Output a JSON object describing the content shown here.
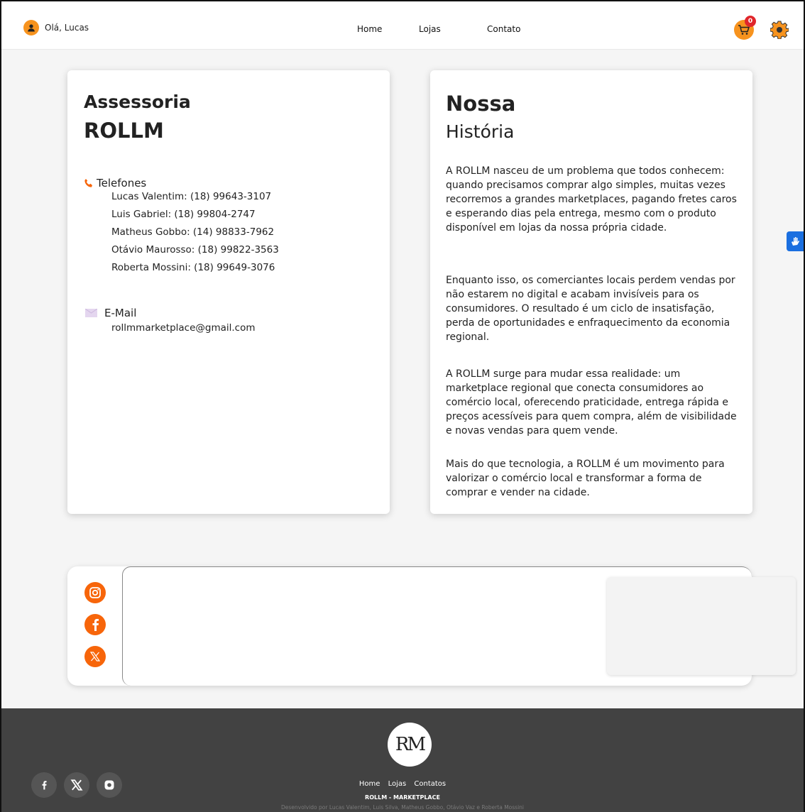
{
  "header": {
    "greeting": "Olá, Lucas",
    "nav": [
      "Home",
      "Lojas",
      "Contato"
    ],
    "cart_count": "0"
  },
  "assessoria": {
    "title_line1": "Assessoria",
    "title_line2": "ROLLM",
    "phones_label": "Telefones",
    "phones": [
      "Lucas Valentim: (18) 99643-3107",
      "Luis Gabriel: (18) 99804-2747",
      "Matheus Gobbo: (14) 98833-7962",
      "Otávio Maurosso: (18) 99822-3563",
      "Roberta Mossini: (18) 99649-3076"
    ],
    "email_label": "E-Mail",
    "email": "rollmmarketplace@gmail.com"
  },
  "historia": {
    "title_line1": "Nossa",
    "title_line2": "História",
    "paragraphs": [
      "A ROLLM nasceu de um problema que todos conhecem: quando precisamos comprar algo simples, muitas vezes recorremos a grandes marketplaces, pagando fretes caros e esperando dias pela entrega, mesmo com o produto disponível em lojas da nossa própria cidade.",
      "Enquanto isso, os comerciantes locais perdem vendas por não estarem no digital e acabam invisíveis para os consumidores. O resultado é um ciclo de insatisfação, perda de oportunidades e enfraquecimento da economia regional.",
      "A ROLLM surge para mudar essa realidade: um marketplace regional que conecta consumidores ao comércio local, oferecendo praticidade, entrega rápida e preços acessíveis para quem compra, além de visibilidade e novas vendas para quem vende.",
      "Mais do que tecnologia, a ROLLM é um movimento para valorizar o comércio local e transformar a forma de comprar e vender na cidade."
    ]
  },
  "social": {
    "icons": [
      "instagram-icon",
      "facebook-icon",
      "x-icon"
    ]
  },
  "footer": {
    "logo_text": "RM",
    "nav": [
      "Home",
      "Lojas",
      "Contatos"
    ],
    "title": "ROLLM - MARKETPLACE",
    "credit": "Desenvolvido por Lucas Valentim, Luis Silva, Matheus Gobbo, Otávio Vaz e Roberta Mossini"
  },
  "colors": {
    "accent": "#f7931e",
    "social_orange": "#f7650a",
    "footer_bg": "#424242",
    "badge_red": "#e0262b",
    "accessibility_blue": "#1a6fe0"
  }
}
